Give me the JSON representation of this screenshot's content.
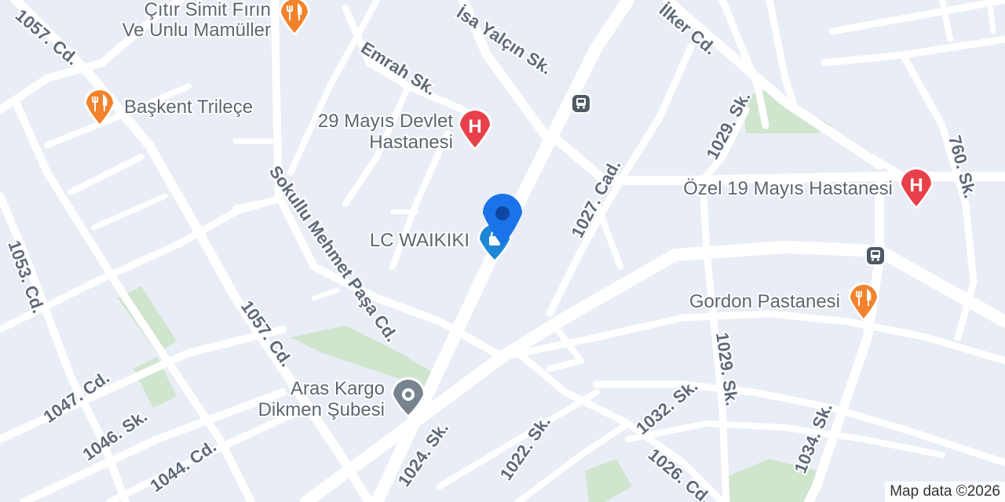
{
  "map": {
    "attribution": "Map data ©2026",
    "colors": {
      "background": "#e9edf5",
      "road": "#ffffff",
      "park": "#cfe5cd",
      "label": "#5f6a7a",
      "food": "#f2822b",
      "hospital": "#e8404a",
      "transit": "#4e5b66",
      "place": "#778490",
      "location": "#1a73e8"
    },
    "roads": {
      "r1": "1057. Cd.",
      "r2": "İsa Yalçın Sk.",
      "r3": "İlker Cd.",
      "r4": "Emrah Sk.",
      "r5": "1029. Sk.",
      "r6": "760. Sk.",
      "r7": "1027. Cad.",
      "r8": "Sokullu Mehmet Paşa Cd.",
      "r9": "1053. Cd.",
      "r10": "1057. Cd.",
      "r11": "1047. Cd.",
      "r12": "1046. Sk.",
      "r13": "1044. Cd.",
      "r14": "1024. Sk.",
      "r15": "1022. Sk.",
      "r16": "1032. Sk.",
      "r17": "1029. Sk.",
      "r18": "1026. Cd.",
      "r19": "1034. Sk."
    },
    "pois": {
      "simit": {
        "line1": "Çıtır Simit Fırın",
        "line2": "Ve Unlu Mamüller",
        "icon": "restaurant-icon"
      },
      "trilece": {
        "label": "Başkent Trileçe",
        "icon": "restaurant-icon"
      },
      "devlet": {
        "line1": "29 Mayıs Devlet",
        "line2": "Hastanesi",
        "icon": "hospital-icon",
        "glyph": "H"
      },
      "ozel": {
        "label": "Özel 19 Mayıs Hastanesi",
        "icon": "hospital-icon",
        "glyph": "H"
      },
      "waikiki": {
        "label": "LC WAIKIKI",
        "icon": "shopping-bag-icon"
      },
      "gordon": {
        "label": "Gordon Pastanesi",
        "icon": "restaurant-icon"
      },
      "aras": {
        "line1": "Aras Kargo",
        "line2": "Dikmen Şubesi",
        "icon": "place-icon"
      }
    }
  }
}
